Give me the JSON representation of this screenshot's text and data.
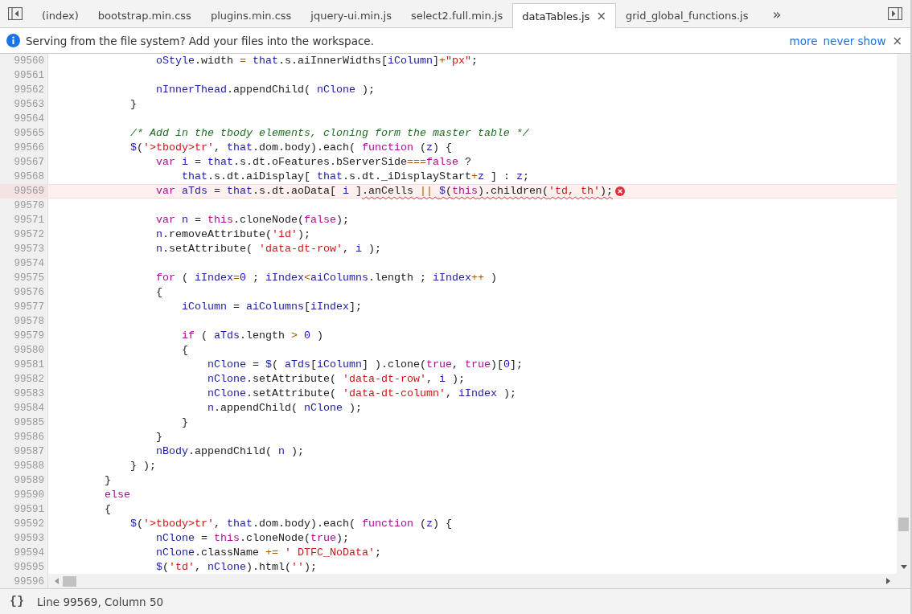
{
  "tabs": [
    {
      "label": "(index)",
      "selected": false
    },
    {
      "label": "bootstrap.min.css",
      "selected": false
    },
    {
      "label": "plugins.min.css",
      "selected": false
    },
    {
      "label": "jquery-ui.min.js",
      "selected": false
    },
    {
      "label": "select2.full.min.js",
      "selected": false
    },
    {
      "label": "dataTables.js",
      "selected": true
    },
    {
      "label": "grid_global_functions.js",
      "selected": false
    }
  ],
  "tab_overflow": "»",
  "infobar": {
    "message": "Serving from the file system? Add your files into the workspace.",
    "links": [
      "more",
      "never show"
    ],
    "close": "×"
  },
  "tab_close": "×",
  "code_lines": [
    {
      "number": "99560",
      "error": false,
      "tokens": [
        {
          "text": "                oStyle",
          "kind": "var"
        },
        {
          "text": ".width ",
          "kind": "plain"
        },
        {
          "text": "= ",
          "kind": "op"
        },
        {
          "text": "that",
          "kind": "var"
        },
        {
          "text": ".s.aiInnerWidths[",
          "kind": "plain"
        },
        {
          "text": "iColumn",
          "kind": "var"
        },
        {
          "text": "]",
          "kind": "plain"
        },
        {
          "text": "+",
          "kind": "op"
        },
        {
          "text": "\"px\"",
          "kind": "string"
        },
        {
          "text": ";",
          "kind": "plain"
        }
      ]
    },
    {
      "number": "99561",
      "error": false
    },
    {
      "number": "99562",
      "error": false,
      "tokens": [
        {
          "text": "                nInnerThead",
          "kind": "var"
        },
        {
          "text": ".appendChild( ",
          "kind": "plain"
        },
        {
          "text": "nClone",
          "kind": "var"
        },
        {
          "text": " );",
          "kind": "plain"
        }
      ]
    },
    {
      "number": "99563",
      "error": false,
      "tokens": [
        {
          "text": "            }",
          "kind": "plain"
        }
      ]
    },
    {
      "number": "99564",
      "error": false
    },
    {
      "number": "99565",
      "error": false,
      "tokens": [
        {
          "text": "            /* Add in the tbody elements, cloning form the master table */",
          "kind": "comment"
        }
      ]
    },
    {
      "number": "99566",
      "error": false,
      "tokens": [
        {
          "text": "            $",
          "kind": "var"
        },
        {
          "text": "(",
          "kind": "plain"
        },
        {
          "text": "'>tbody>tr'",
          "kind": "string"
        },
        {
          "text": ", ",
          "kind": "plain"
        },
        {
          "text": "that",
          "kind": "var"
        },
        {
          "text": ".dom.body).each( ",
          "kind": "plain"
        },
        {
          "text": "function",
          "kind": "keyword"
        },
        {
          "text": " (",
          "kind": "plain"
        },
        {
          "text": "z",
          "kind": "var"
        },
        {
          "text": ") {",
          "kind": "plain"
        }
      ]
    },
    {
      "number": "99567",
      "error": false,
      "tokens": [
        {
          "text": "                var ",
          "kind": "keyword"
        },
        {
          "text": "i",
          "kind": "var"
        },
        {
          "text": " = ",
          "kind": "plain"
        },
        {
          "text": "that",
          "kind": "var"
        },
        {
          "text": ".s.dt.oFeatures.bServerSide",
          "kind": "plain"
        },
        {
          "text": "===",
          "kind": "op"
        },
        {
          "text": "false",
          "kind": "keyword"
        },
        {
          "text": " ?",
          "kind": "plain"
        }
      ]
    },
    {
      "number": "99568",
      "error": false,
      "tokens": [
        {
          "text": "                    that",
          "kind": "var"
        },
        {
          "text": ".s.dt.aiDisplay[ ",
          "kind": "plain"
        },
        {
          "text": "that",
          "kind": "var"
        },
        {
          "text": ".s.dt._iDisplayStart",
          "kind": "plain"
        },
        {
          "text": "+",
          "kind": "op"
        },
        {
          "text": "z",
          "kind": "var"
        },
        {
          "text": " ] : ",
          "kind": "plain"
        },
        {
          "text": "z",
          "kind": "var"
        },
        {
          "text": ";",
          "kind": "plain"
        }
      ]
    },
    {
      "number": "99569",
      "error": true,
      "tokens": [
        {
          "text": "                var ",
          "kind": "keyword"
        },
        {
          "text": "aTds",
          "kind": "var"
        },
        {
          "text": " = ",
          "kind": "plain"
        },
        {
          "text": "that",
          "kind": "var"
        },
        {
          "text": ".s.dt.aoData[ ",
          "kind": "plain"
        },
        {
          "text": "i",
          "kind": "var"
        },
        {
          "text": " ]",
          "kind": "plain"
        },
        {
          "text": ".anCells ",
          "kind": "plain",
          "wavy": true
        },
        {
          "text": "|| ",
          "kind": "op",
          "wavy": true
        },
        {
          "text": "$",
          "kind": "var",
          "wavy": true
        },
        {
          "text": "(",
          "kind": "plain",
          "wavy": true
        },
        {
          "text": "this",
          "kind": "keyword",
          "wavy": true
        },
        {
          "text": ").children(",
          "kind": "plain",
          "wavy": true
        },
        {
          "text": "'td, th'",
          "kind": "string",
          "wavy": true
        },
        {
          "text": ");",
          "kind": "plain",
          "wavy": true
        }
      ]
    },
    {
      "number": "99570",
      "error": false
    },
    {
      "number": "99571",
      "error": false,
      "tokens": [
        {
          "text": "                var ",
          "kind": "keyword"
        },
        {
          "text": "n",
          "kind": "var"
        },
        {
          "text": " = ",
          "kind": "plain"
        },
        {
          "text": "this",
          "kind": "keyword"
        },
        {
          "text": ".cloneNode(",
          "kind": "plain"
        },
        {
          "text": "false",
          "kind": "keyword"
        },
        {
          "text": ");",
          "kind": "plain"
        }
      ]
    },
    {
      "number": "99572",
      "error": false,
      "tokens": [
        {
          "text": "                n",
          "kind": "var"
        },
        {
          "text": ".removeAttribute(",
          "kind": "plain"
        },
        {
          "text": "'id'",
          "kind": "string"
        },
        {
          "text": ");",
          "kind": "plain"
        }
      ]
    },
    {
      "number": "99573",
      "error": false,
      "tokens": [
        {
          "text": "                n",
          "kind": "var"
        },
        {
          "text": ".setAttribute( ",
          "kind": "plain"
        },
        {
          "text": "'data-dt-row'",
          "kind": "string"
        },
        {
          "text": ", ",
          "kind": "plain"
        },
        {
          "text": "i",
          "kind": "var"
        },
        {
          "text": " );",
          "kind": "plain"
        }
      ]
    },
    {
      "number": "99574",
      "error": false
    },
    {
      "number": "99575",
      "error": false,
      "tokens": [
        {
          "text": "                for",
          "kind": "keyword"
        },
        {
          "text": " ( ",
          "kind": "plain"
        },
        {
          "text": "iIndex",
          "kind": "var"
        },
        {
          "text": "=",
          "kind": "op"
        },
        {
          "text": "0",
          "kind": "number"
        },
        {
          "text": " ; ",
          "kind": "plain"
        },
        {
          "text": "iIndex",
          "kind": "var"
        },
        {
          "text": "<",
          "kind": "op"
        },
        {
          "text": "aiColumns",
          "kind": "var"
        },
        {
          "text": ".length ; ",
          "kind": "plain"
        },
        {
          "text": "iIndex",
          "kind": "var"
        },
        {
          "text": "++",
          "kind": "op"
        },
        {
          "text": " )",
          "kind": "plain"
        }
      ]
    },
    {
      "number": "99576",
      "error": false,
      "tokens": [
        {
          "text": "                {",
          "kind": "plain"
        }
      ]
    },
    {
      "number": "99577",
      "error": false,
      "tokens": [
        {
          "text": "                    iColumn",
          "kind": "var"
        },
        {
          "text": " = ",
          "kind": "plain"
        },
        {
          "text": "aiColumns",
          "kind": "var"
        },
        {
          "text": "[",
          "kind": "plain"
        },
        {
          "text": "iIndex",
          "kind": "var"
        },
        {
          "text": "];",
          "kind": "plain"
        }
      ]
    },
    {
      "number": "99578",
      "error": false
    },
    {
      "number": "99579",
      "error": false,
      "tokens": [
        {
          "text": "                    if",
          "kind": "keyword"
        },
        {
          "text": " ( ",
          "kind": "plain"
        },
        {
          "text": "aTds",
          "kind": "var"
        },
        {
          "text": ".length ",
          "kind": "plain"
        },
        {
          "text": "> ",
          "kind": "op"
        },
        {
          "text": "0",
          "kind": "number"
        },
        {
          "text": " )",
          "kind": "plain"
        }
      ]
    },
    {
      "number": "99580",
      "error": false,
      "tokens": [
        {
          "text": "                    {",
          "kind": "plain"
        }
      ]
    },
    {
      "number": "99581",
      "error": false,
      "tokens": [
        {
          "text": "                        nClone",
          "kind": "var"
        },
        {
          "text": " = ",
          "kind": "plain"
        },
        {
          "text": "$",
          "kind": "var"
        },
        {
          "text": "( ",
          "kind": "plain"
        },
        {
          "text": "aTds",
          "kind": "var"
        },
        {
          "text": "[",
          "kind": "plain"
        },
        {
          "text": "iColumn",
          "kind": "var"
        },
        {
          "text": "] ).clone(",
          "kind": "plain"
        },
        {
          "text": "true",
          "kind": "keyword"
        },
        {
          "text": ", ",
          "kind": "plain"
        },
        {
          "text": "true",
          "kind": "keyword"
        },
        {
          "text": ")[",
          "kind": "plain"
        },
        {
          "text": "0",
          "kind": "number"
        },
        {
          "text": "];",
          "kind": "plain"
        }
      ]
    },
    {
      "number": "99582",
      "error": false,
      "tokens": [
        {
          "text": "                        nClone",
          "kind": "var"
        },
        {
          "text": ".setAttribute( ",
          "kind": "plain"
        },
        {
          "text": "'data-dt-row'",
          "kind": "string"
        },
        {
          "text": ", ",
          "kind": "plain"
        },
        {
          "text": "i",
          "kind": "var"
        },
        {
          "text": " );",
          "kind": "plain"
        }
      ]
    },
    {
      "number": "99583",
      "error": false,
      "tokens": [
        {
          "text": "                        nClone",
          "kind": "var"
        },
        {
          "text": ".setAttribute( ",
          "kind": "plain"
        },
        {
          "text": "'data-dt-column'",
          "kind": "string"
        },
        {
          "text": ", ",
          "kind": "plain"
        },
        {
          "text": "iIndex",
          "kind": "var"
        },
        {
          "text": " );",
          "kind": "plain"
        }
      ]
    },
    {
      "number": "99584",
      "error": false,
      "tokens": [
        {
          "text": "                        n",
          "kind": "var"
        },
        {
          "text": ".appendChild( ",
          "kind": "plain"
        },
        {
          "text": "nClone",
          "kind": "var"
        },
        {
          "text": " );",
          "kind": "plain"
        }
      ]
    },
    {
      "number": "99585",
      "error": false,
      "tokens": [
        {
          "text": "                    }",
          "kind": "plain"
        }
      ]
    },
    {
      "number": "99586",
      "error": false,
      "tokens": [
        {
          "text": "                }",
          "kind": "plain"
        }
      ]
    },
    {
      "number": "99587",
      "error": false,
      "tokens": [
        {
          "text": "                nBody",
          "kind": "var"
        },
        {
          "text": ".appendChild( ",
          "kind": "plain"
        },
        {
          "text": "n",
          "kind": "var"
        },
        {
          "text": " );",
          "kind": "plain"
        }
      ]
    },
    {
      "number": "99588",
      "error": false,
      "tokens": [
        {
          "text": "            } );",
          "kind": "plain"
        }
      ]
    },
    {
      "number": "99589",
      "error": false,
      "tokens": [
        {
          "text": "        }",
          "kind": "plain"
        }
      ]
    },
    {
      "number": "99590",
      "error": false,
      "tokens": [
        {
          "text": "        else",
          "kind": "keyword"
        }
      ]
    },
    {
      "number": "99591",
      "error": false,
      "tokens": [
        {
          "text": "        {",
          "kind": "plain"
        }
      ]
    },
    {
      "number": "99592",
      "error": false,
      "tokens": [
        {
          "text": "            $",
          "kind": "var"
        },
        {
          "text": "(",
          "kind": "plain"
        },
        {
          "text": "'>tbody>tr'",
          "kind": "string"
        },
        {
          "text": ", ",
          "kind": "plain"
        },
        {
          "text": "that",
          "kind": "var"
        },
        {
          "text": ".dom.body).each( ",
          "kind": "plain"
        },
        {
          "text": "function",
          "kind": "keyword"
        },
        {
          "text": " (",
          "kind": "plain"
        },
        {
          "text": "z",
          "kind": "var"
        },
        {
          "text": ") {",
          "kind": "plain"
        }
      ]
    },
    {
      "number": "99593",
      "error": false,
      "tokens": [
        {
          "text": "                nClone",
          "kind": "var"
        },
        {
          "text": " = ",
          "kind": "plain"
        },
        {
          "text": "this",
          "kind": "keyword"
        },
        {
          "text": ".cloneNode(",
          "kind": "plain"
        },
        {
          "text": "true",
          "kind": "keyword"
        },
        {
          "text": ");",
          "kind": "plain"
        }
      ]
    },
    {
      "number": "99594",
      "error": false,
      "tokens": [
        {
          "text": "                nClone",
          "kind": "var"
        },
        {
          "text": ".className ",
          "kind": "plain"
        },
        {
          "text": "+= ",
          "kind": "op"
        },
        {
          "text": "' DTFC_NoData'",
          "kind": "string"
        },
        {
          "text": ";",
          "kind": "plain"
        }
      ]
    },
    {
      "number": "99595",
      "error": false,
      "tokens": [
        {
          "text": "                $",
          "kind": "var"
        },
        {
          "text": "(",
          "kind": "plain"
        },
        {
          "text": "'td'",
          "kind": "string"
        },
        {
          "text": ", ",
          "kind": "plain"
        },
        {
          "text": "nClone",
          "kind": "var"
        },
        {
          "text": ").html(",
          "kind": "plain"
        },
        {
          "text": "''",
          "kind": "string"
        },
        {
          "text": ");",
          "kind": "plain"
        }
      ]
    },
    {
      "number": "99596",
      "error": false
    }
  ],
  "status_bar": {
    "format_button": "{}",
    "position": "Line 99569, Column 50"
  }
}
